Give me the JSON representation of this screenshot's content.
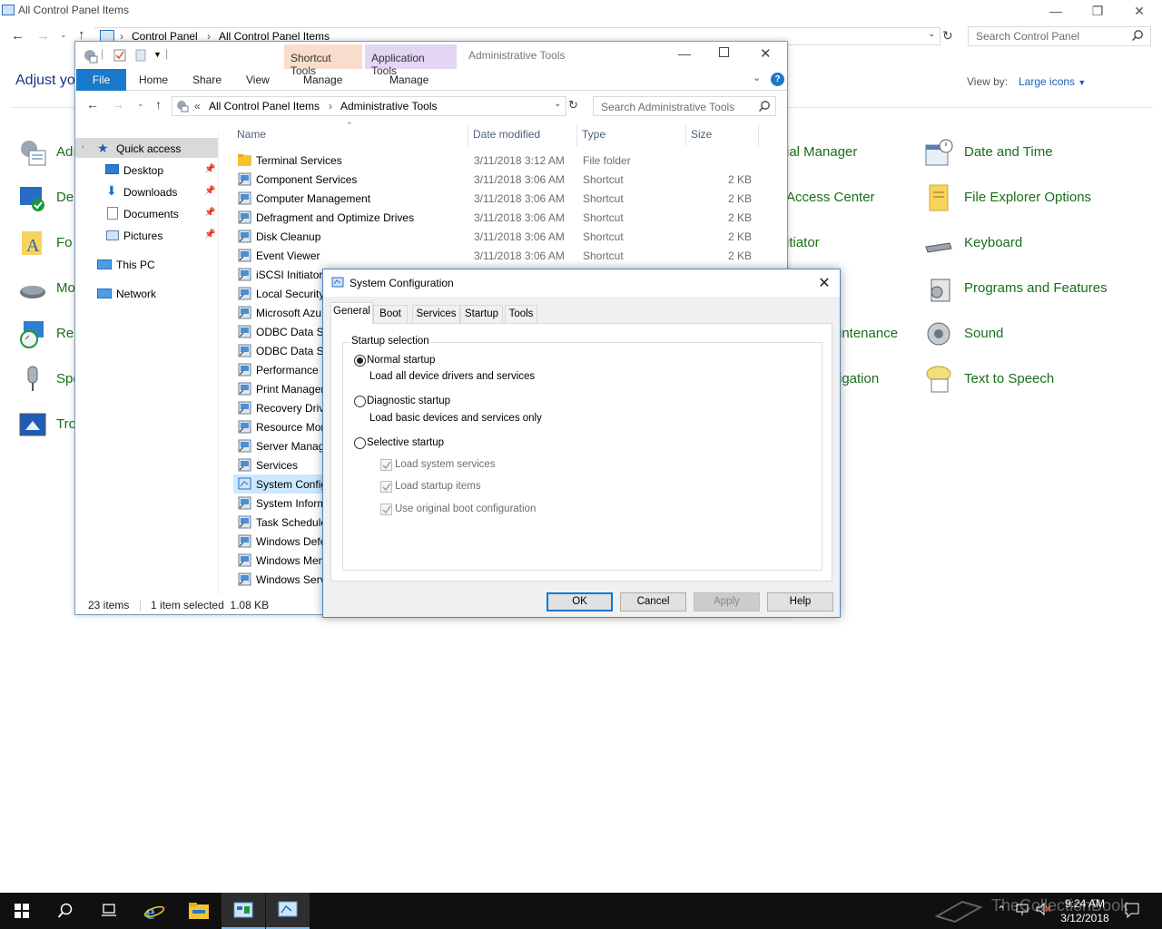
{
  "control_panel": {
    "title": "All Control Panel Items",
    "breadcrumb": [
      "Control Panel",
      "All Control Panel Items"
    ],
    "search_placeholder": "Search Control Panel",
    "heading": "Adjust yo",
    "view_by_label": "View by:",
    "view_by_value": "Large icons",
    "left_items": [
      "Adı",
      "De",
      "Fo",
      "Mo",
      "Re",
      "Spe",
      "Tro"
    ],
    "mid_items": [
      "ial Manager",
      "Access Center",
      "itiator",
      "intenance",
      "igation"
    ],
    "right_items": [
      "Date and Time",
      "File Explorer Options",
      "Keyboard",
      "Programs and Features",
      "Sound",
      "Text to Speech"
    ]
  },
  "explorer": {
    "title": "Administrative Tools",
    "context_tabs": [
      "Shortcut Tools",
      "Application Tools"
    ],
    "ribbon_tabs": [
      "File",
      "Home",
      "Share",
      "View",
      "Manage",
      "Manage"
    ],
    "address_prefix": "«",
    "breadcrumb": [
      "All Control Panel Items",
      "Administrative Tools"
    ],
    "search_placeholder": "Search Administrative Tools",
    "nav": {
      "quick_access": "Quick access",
      "pinned": [
        "Desktop",
        "Downloads",
        "Documents",
        "Pictures"
      ],
      "this_pc": "This PC",
      "network": "Network"
    },
    "columns": [
      "Name",
      "Date modified",
      "Type",
      "Size"
    ],
    "rows": [
      {
        "name": "Terminal Services",
        "date": "3/11/2018 3:12 AM",
        "type": "File folder",
        "size": ""
      },
      {
        "name": "Component Services",
        "date": "3/11/2018 3:06 AM",
        "type": "Shortcut",
        "size": "2 KB"
      },
      {
        "name": "Computer Management",
        "date": "3/11/2018 3:06 AM",
        "type": "Shortcut",
        "size": "2 KB"
      },
      {
        "name": "Defragment and Optimize Drives",
        "date": "3/11/2018 3:06 AM",
        "type": "Shortcut",
        "size": "2 KB"
      },
      {
        "name": "Disk Cleanup",
        "date": "3/11/2018 3:06 AM",
        "type": "Shortcut",
        "size": "2 KB"
      },
      {
        "name": "Event Viewer",
        "date": "3/11/2018 3:06 AM",
        "type": "Shortcut",
        "size": "2 KB"
      },
      {
        "name": "iSCSI Initiator",
        "date": "",
        "type": "",
        "size": ""
      },
      {
        "name": "Local Security",
        "date": "",
        "type": "",
        "size": ""
      },
      {
        "name": "Microsoft Azu",
        "date": "",
        "type": "",
        "size": ""
      },
      {
        "name": "ODBC Data So",
        "date": "",
        "type": "",
        "size": ""
      },
      {
        "name": "ODBC Data So",
        "date": "",
        "type": "",
        "size": ""
      },
      {
        "name": "Performance I",
        "date": "",
        "type": "",
        "size": ""
      },
      {
        "name": "Print Manager",
        "date": "",
        "type": "",
        "size": ""
      },
      {
        "name": "Recovery Drive",
        "date": "",
        "type": "",
        "size": ""
      },
      {
        "name": "Resource Mon",
        "date": "",
        "type": "",
        "size": ""
      },
      {
        "name": "Server Manag",
        "date": "",
        "type": "",
        "size": ""
      },
      {
        "name": "Services",
        "date": "",
        "type": "",
        "size": ""
      },
      {
        "name": "System Config",
        "date": "",
        "type": "",
        "size": ""
      },
      {
        "name": "System Inform",
        "date": "",
        "type": "",
        "size": ""
      },
      {
        "name": "Task Schedule",
        "date": "",
        "type": "",
        "size": ""
      },
      {
        "name": "Windows Defe",
        "date": "",
        "type": "",
        "size": ""
      },
      {
        "name": "Windows Mem",
        "date": "",
        "type": "",
        "size": ""
      },
      {
        "name": "Windows Serv",
        "date": "",
        "type": "",
        "size": ""
      }
    ],
    "status_items": "23 items",
    "status_selected": "1 item selected  1.08 KB"
  },
  "dialog": {
    "title": "System Configuration",
    "tabs": [
      "General",
      "Boot",
      "Services",
      "Startup",
      "Tools"
    ],
    "group_label": "Startup selection",
    "options": [
      {
        "label": "Normal startup",
        "desc": "Load all device drivers and services",
        "selected": true
      },
      {
        "label": "Diagnostic startup",
        "desc": "Load basic devices and services only",
        "selected": false
      },
      {
        "label": "Selective startup",
        "desc": "",
        "selected": false
      }
    ],
    "checkboxes": [
      "Load system services",
      "Load startup items",
      "Use original boot configuration"
    ],
    "buttons": {
      "ok": "OK",
      "cancel": "Cancel",
      "apply": "Apply",
      "help": "Help"
    }
  },
  "taskbar": {
    "time": "9:24 AM",
    "date": "3/12/2018",
    "watermark": "TheCollectionBook"
  },
  "colors": {
    "accent": "#0078d7",
    "file_tab": "#1979ca",
    "shortcut_tools": "#f7d7c4",
    "application_tools": "#dcd0f0",
    "link_green": "#1a6e1a",
    "selected_row": "#cce8ff"
  }
}
